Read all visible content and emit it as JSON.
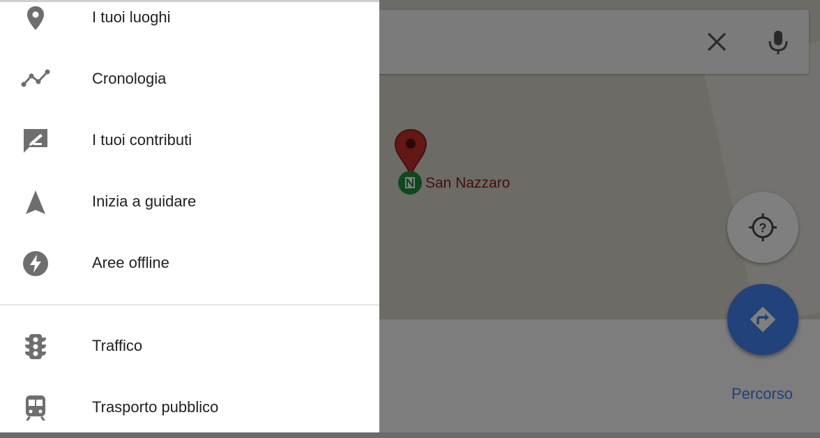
{
  "drawer": {
    "items": [
      {
        "label": "I tuoi luoghi",
        "icon": "place-pin-icon"
      },
      {
        "label": "Cronologia",
        "icon": "timeline-icon"
      },
      {
        "label": "I tuoi contributi",
        "icon": "contribute-icon"
      },
      {
        "label": "Inizia a guidare",
        "icon": "navigation-arrow-icon"
      },
      {
        "label": "Aree offline",
        "icon": "offline-bolt-icon"
      }
    ],
    "layers": [
      {
        "label": "Traffico",
        "icon": "traffic-light-icon"
      },
      {
        "label": "Trasporto pubblico",
        "icon": "train-icon"
      }
    ]
  },
  "map": {
    "place_label": "San Nazzaro",
    "directions_label": "Percorso"
  },
  "colors": {
    "accent": "#4285f4",
    "pin": "#c5302b",
    "poi": "#1e8e3e",
    "icon_gray": "#6e6e6e"
  }
}
